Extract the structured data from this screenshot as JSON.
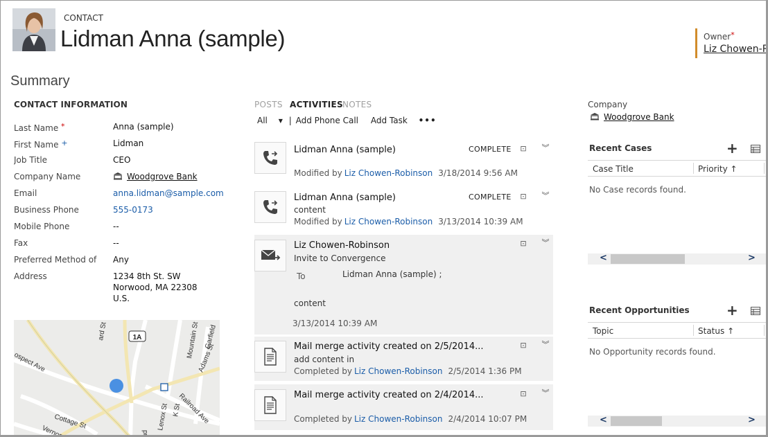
{
  "header": {
    "entity_type": "CONTACT",
    "title": "Lidman Anna (sample)",
    "owner_label": "Owner",
    "owner_required": "*",
    "owner_value": "Liz Chowen-R"
  },
  "summary_title": "Summary",
  "contact_info": {
    "heading": "CONTACT INFORMATION",
    "required_marker": "*",
    "recommended_marker": "+",
    "fields": [
      {
        "label": "Last Name",
        "value": "Anna (sample)"
      },
      {
        "label": "First Name",
        "value": "Lidman"
      },
      {
        "label": "Job Title",
        "value": "CEO"
      },
      {
        "label": "Company Name",
        "value": "Woodgrove Bank"
      },
      {
        "label": "Email",
        "value": "anna.lidman@sample.com"
      },
      {
        "label": "Business Phone",
        "value": "555-0173"
      },
      {
        "label": "Mobile Phone",
        "value": "--"
      },
      {
        "label": "Fax",
        "value": "--"
      },
      {
        "label": "Preferred Method of",
        "value": "Any"
      },
      {
        "label": "Address",
        "value": "1234 8th St. SW",
        "line2": "Norwood, MA 22308",
        "line3": "U.S."
      }
    ]
  },
  "map": {
    "labels": [
      "1A",
      "Cottage St",
      "Vernon St",
      "ospect Ave",
      "Lenox St",
      "Railroad Ave",
      "K St",
      "Mountain St",
      "Adams St",
      "Garfield",
      "ard St",
      "ad"
    ]
  },
  "activities": {
    "tabs": [
      "POSTS",
      "ACTIVITIES",
      "NOTES"
    ],
    "filter": "All",
    "actions": [
      "Add Phone Call",
      "Add Task"
    ],
    "more": "•••",
    "items": [
      {
        "icon": "phone-call-icon",
        "title": "Lidman Anna (sample)",
        "status": "COMPLETE",
        "meta_prefix": "Modified by",
        "who": "Liz Chowen-Robinson",
        "when": "3/18/2014 9:56 AM"
      },
      {
        "icon": "phone-call-icon",
        "title": "Lidman Anna (sample)",
        "status": "COMPLETE",
        "line": "content",
        "meta_prefix": "Modified by",
        "who": "Liz Chowen-Robinson",
        "when": "3/13/2014 10:39 AM"
      },
      {
        "icon": "email-icon",
        "title": "Liz Chowen-Robinson",
        "subject": "Invite to Convergence",
        "to_label": "To",
        "to_value": "Lidman Anna (sample) ;",
        "body": "content",
        "when": "3/13/2014 10:39 AM"
      },
      {
        "icon": "document-icon",
        "title": "Mail merge activity created on 2/5/2014...",
        "line": "add content in",
        "meta_prefix": "Completed by",
        "who": "Liz Chowen-Robinson",
        "when": "2/5/2014 1:36 PM"
      },
      {
        "icon": "document-icon",
        "title": "Mail merge activity created on 2/4/2014...",
        "meta_prefix": "Completed by",
        "who": "Liz Chowen-Robinson",
        "when": "2/4/2014 10:07 PM"
      }
    ]
  },
  "right": {
    "company_label": "Company",
    "company_value": "Woodgrove Bank",
    "cases": {
      "heading": "Recent Cases",
      "columns": [
        "Case Title",
        "Priority"
      ],
      "empty": "No Case records found."
    },
    "opportunities": {
      "heading": "Recent Opportunities",
      "columns": [
        "Topic",
        "Status"
      ],
      "empty": "No Opportunity records found."
    }
  },
  "colors": {
    "link": "#1a5ca8",
    "owner_accent": "#d18c2b",
    "required": "#cc0000"
  }
}
